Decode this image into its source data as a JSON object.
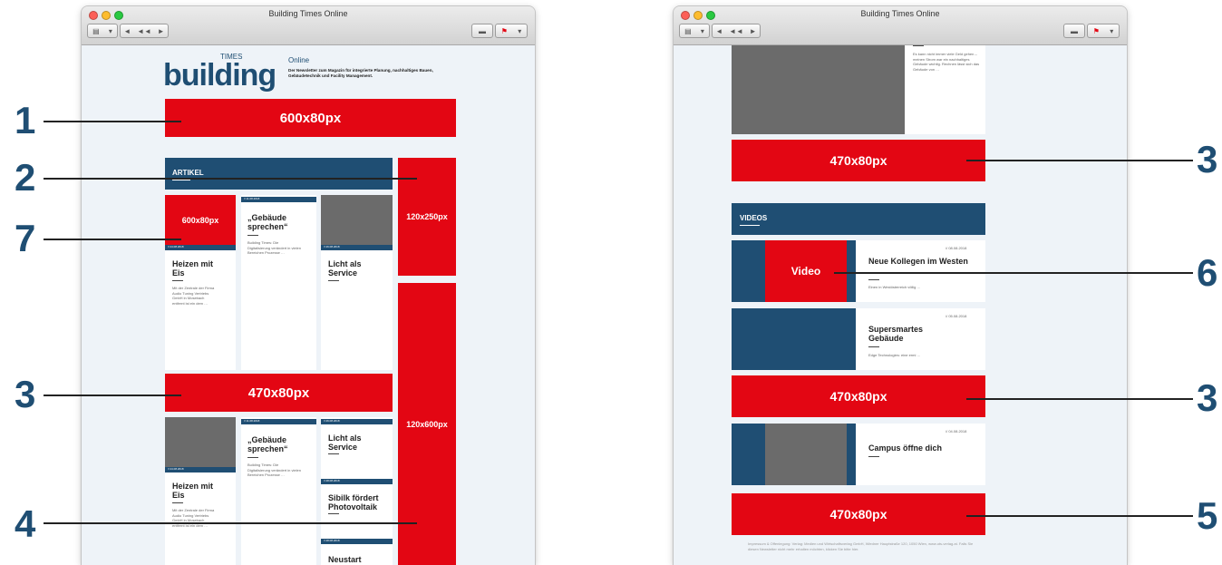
{
  "window_title": "Building Times Online",
  "logo": {
    "main": "building",
    "sup": "TIMES"
  },
  "online_label": "Online",
  "tagline": "Der Newsletter zum Magazin für integrierte Planung, nachhaltiges Bauen, Gebäudetechnik und Facility Management.",
  "ads": {
    "banner_600": "600x80px",
    "box_120x250": "120x250px",
    "box_120x600": "120x600px",
    "box_470": "470x80px",
    "small_600": "600x80px",
    "video": "Video"
  },
  "sections": {
    "artikel": "ARTIKEL",
    "videos": "VIDEOS"
  },
  "articles": {
    "heizen": {
      "title": "Heizen mit Eis",
      "date": "// 24.08.2018",
      "text": "Mit der Zentrale der Firma Audio Tuning Vertriebs GmbH in Mosebach entfernt ist ein dem …"
    },
    "gebaeude": {
      "title": "„Gebäude sprechen“",
      "date": "// 11.08.2018",
      "text": "Building Times: Die Digitalisierung verändert in vielen Bereichen Prozesse …"
    },
    "licht": {
      "title": "Licht als Service",
      "date": "// 26.08.2018"
    },
    "sibilk": {
      "title": "Sibilk fördert Photovoltaik",
      "date": "// 28.08.2018"
    },
    "neustart": {
      "title": "Neustart",
      "date": "// 28.08.2018"
    },
    "cut_text": "Es kann nicht immer viele Geld gehen – meinen Strom war ein nachhaltiges Gebäude wichtig. Rechnen lässt sich das Gebäude von …"
  },
  "videos": [
    {
      "title": "Neue Kollegen im Westen",
      "date": "// 08.08.2018",
      "text": "Einen in Westösterreich völlig …"
    },
    {
      "title": "Supersmartes Gebäude",
      "date": "// 05.08.2018",
      "text": "Edge Technologies: eine ermi …"
    },
    {
      "title": "Campus öffne dich",
      "date": "// 04.08.2018"
    }
  ],
  "footer_text": "Impressum & Offenlegung: Verlag: Medien und Wirtschaftsverlag GmbH, Wiedner Hauptstraße 120, 1050 Wien, www.ots-verlag.at. Falls Sie diesen Newsletter nicht mehr erhalten möchten, klicken Sie bitte hier.",
  "callouts": {
    "c1": "1",
    "c2": "2",
    "c3": "3",
    "c4": "4",
    "c5": "5",
    "c6": "6",
    "c7": "7"
  },
  "colors": {
    "red": "#e30613",
    "navy": "#1f4e73",
    "callout": "#1f4e73"
  }
}
